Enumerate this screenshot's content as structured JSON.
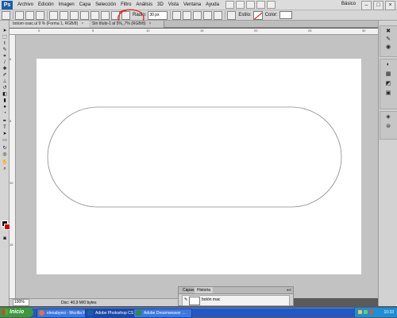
{
  "app": {
    "logo": "Ps"
  },
  "menu": [
    "Archivo",
    "Edición",
    "Imagen",
    "Capa",
    "Selección",
    "Filtro",
    "Análisis",
    "3D",
    "Vista",
    "Ventana",
    "Ayuda"
  ],
  "workspace": "Básico",
  "options_bar": {
    "radius_label": "Radio:",
    "radius_value": "30 px",
    "style_label": "Estilo:",
    "color_label": "Color:"
  },
  "tabs": [
    {
      "label": "botom osac.ul 9 % (Forma 1, RGB/8)"
    },
    {
      "label": "Sin título-1 al 5%_7% (RGB/8)"
    }
  ],
  "status": {
    "zoom": "100%",
    "doc": "Doc: 40,9 M/0 bytes"
  },
  "panel": {
    "tabs": [
      "Capas",
      "Historia"
    ],
    "history_item": "botón mac"
  },
  "taskbar": {
    "start_label": "Inicio",
    "items": [
      {
        "label": "elenabyesi - Mozilla Fi..."
      },
      {
        "label": "Adobe Photoshop CS..."
      },
      {
        "label": "Adobe Dreamweaver ..."
      }
    ],
    "clock": "10:33"
  },
  "colors": {
    "foreground": "#0a0a0a",
    "background": "#d40000",
    "annotation": "#e02a2a"
  },
  "ruler_labels_top": [
    "0",
    "5",
    "10",
    "15",
    "20",
    "25",
    "30"
  ],
  "ruler_labels_left": [
    "0",
    "5",
    "10",
    "15"
  ]
}
